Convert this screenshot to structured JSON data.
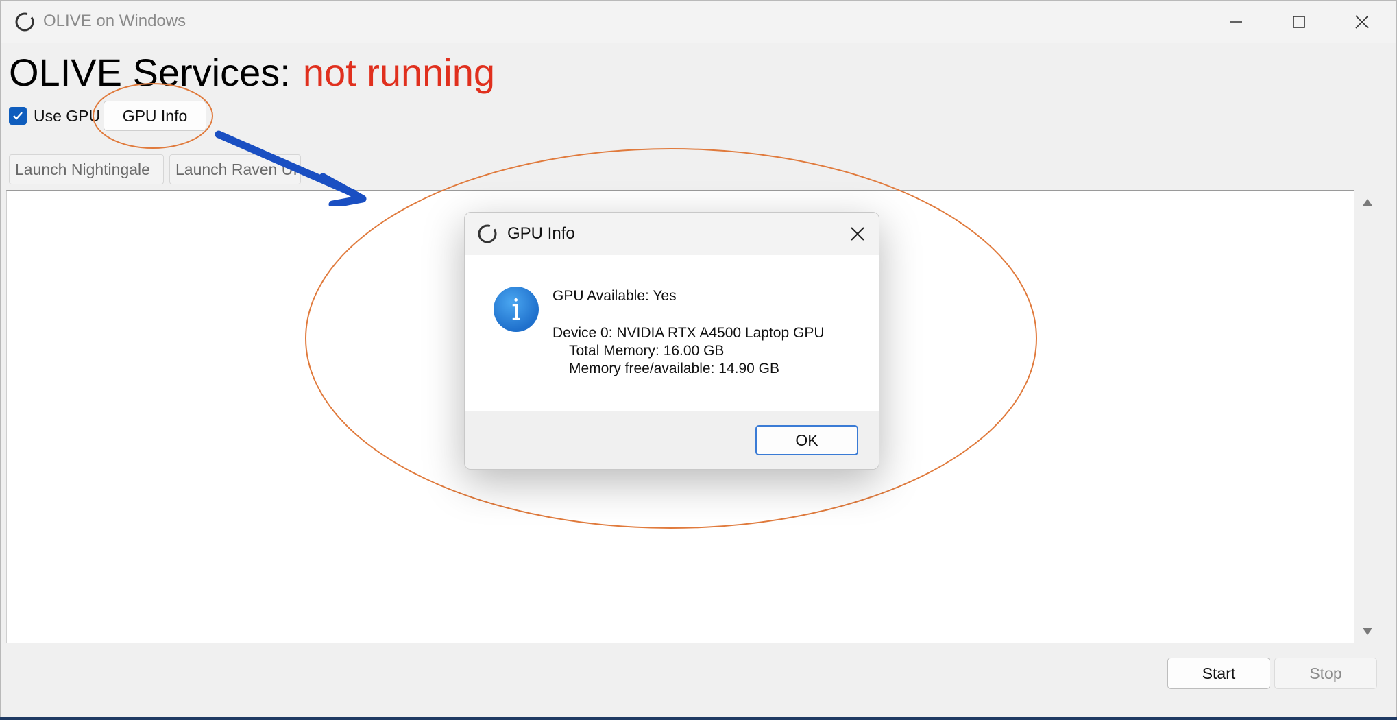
{
  "window": {
    "title": "OLIVE on Windows",
    "controls": {
      "minimize": "minimize-icon",
      "maximize": "maximize-icon",
      "close": "close-icon"
    }
  },
  "services": {
    "label": "OLIVE Services:",
    "status": "not running",
    "status_color": "#e0301e"
  },
  "gpu": {
    "use_gpu_label": "Use GPU",
    "use_gpu_checked": true,
    "gpu_info_button": "GPU Info"
  },
  "launch": {
    "nightingale": "Launch Nightingale",
    "raven": "Launch Raven UI"
  },
  "controls": {
    "start": "Start",
    "stop": "Stop"
  },
  "dialog": {
    "title": "GPU Info",
    "icon": "info-icon",
    "icon_glyph": "i",
    "gpu_available": "GPU Available: Yes",
    "device": "Device 0: NVIDIA RTX A4500 Laptop GPU",
    "total_memory": "Total Memory: 16.00 GB",
    "free_memory": "Memory free/available: 14.90 GB",
    "ok_button": "OK"
  },
  "colors": {
    "annotation": "#e07a3c",
    "arrow": "#1a4fc2",
    "accent": "#0f5dbd"
  }
}
